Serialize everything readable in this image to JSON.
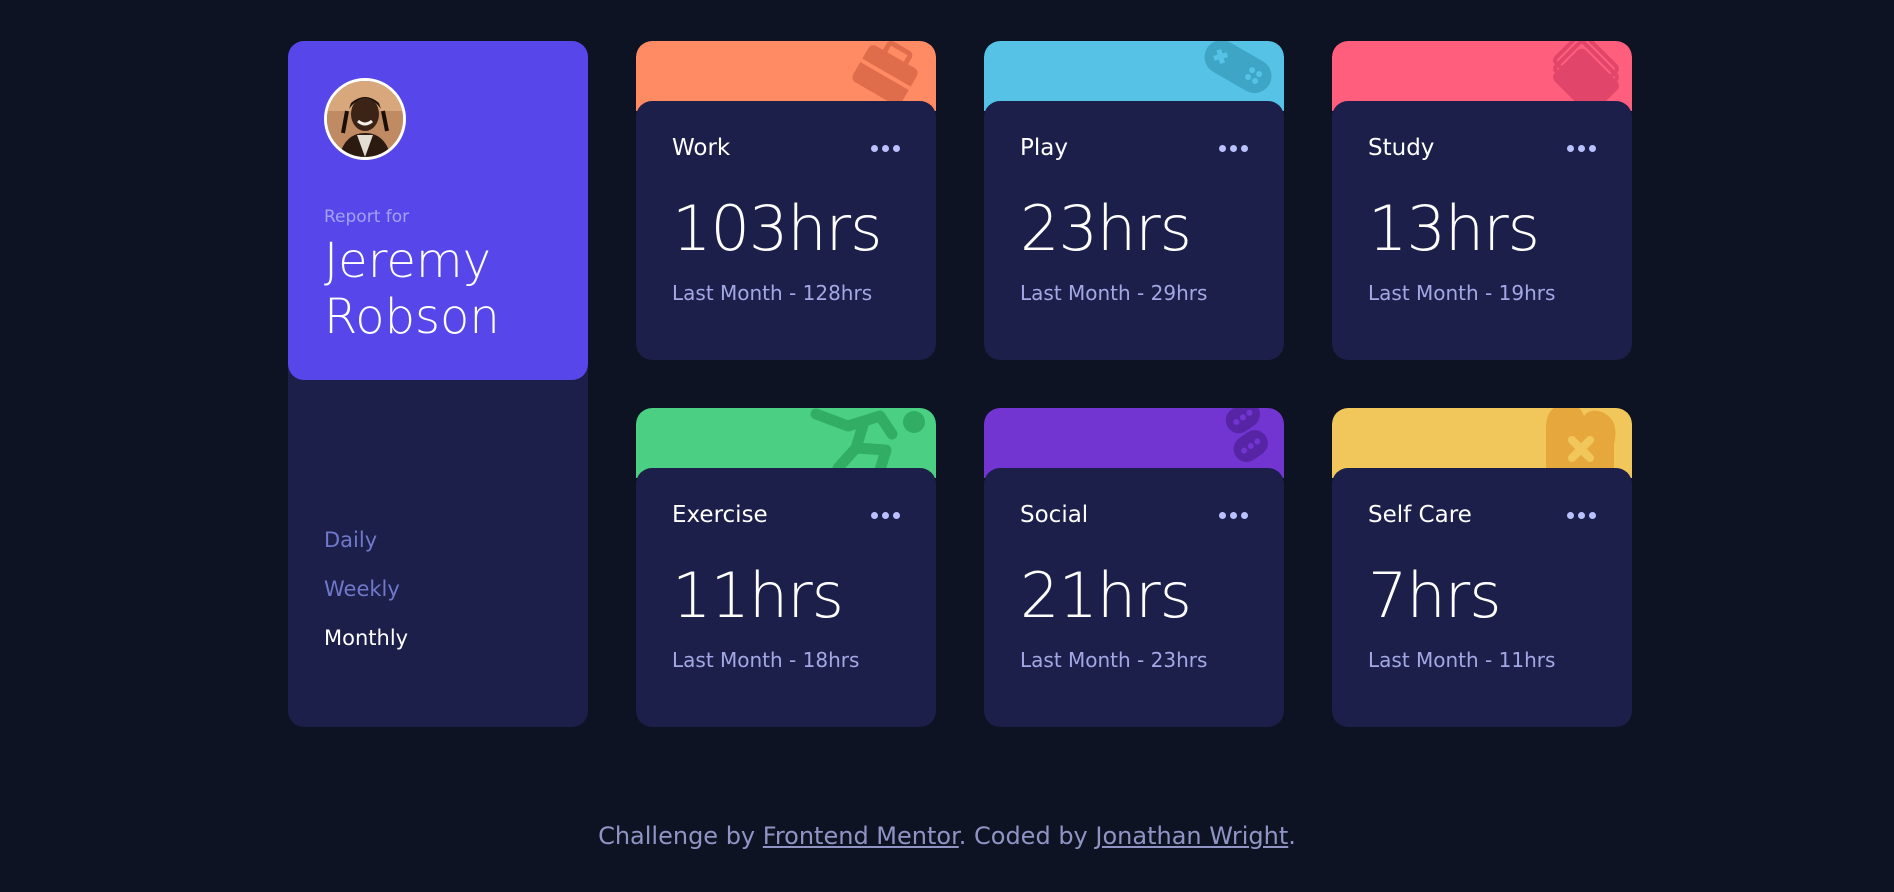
{
  "profile": {
    "report_label": "Report for",
    "name_line1": "Jeremy",
    "name_line2": "Robson",
    "avatar_alt": "user avatar",
    "periods": [
      {
        "label": "Daily",
        "active": false
      },
      {
        "label": "Weekly",
        "active": false
      },
      {
        "label": "Monthly",
        "active": true
      }
    ]
  },
  "cards": [
    {
      "title": "Work",
      "current": "103hrs",
      "previous": "Last Month - 128hrs",
      "color": "#ff8b64",
      "icon": "briefcase-icon"
    },
    {
      "title": "Play",
      "current": "23hrs",
      "previous": "Last Month - 29hrs",
      "color": "#55c2e6",
      "icon": "gamepad-icon"
    },
    {
      "title": "Study",
      "current": "13hrs",
      "previous": "Last Month - 19hrs",
      "color": "#ff5e7d",
      "icon": "book-icon"
    },
    {
      "title": "Exercise",
      "current": "11hrs",
      "previous": "Last Month - 18hrs",
      "color": "#4bcf82",
      "icon": "runner-icon"
    },
    {
      "title": "Social",
      "current": "21hrs",
      "previous": "Last Month - 23hrs",
      "color": "#7335d2",
      "icon": "chat-icon"
    },
    {
      "title": "Self Care",
      "current": "7hrs",
      "previous": "Last Month - 11hrs",
      "color": "#f1c75b",
      "icon": "heart-bandage-icon"
    }
  ],
  "footer": {
    "prefix": "Challenge by ",
    "link1": "Frontend Mentor",
    "middle": ". Coded by ",
    "link2": "Jonathan Wright",
    "suffix": "."
  },
  "colors": {
    "background": "#0d1323",
    "card": "#1c1f4a",
    "profile_accent": "#5747ea",
    "muted": "#bbc0ff"
  }
}
